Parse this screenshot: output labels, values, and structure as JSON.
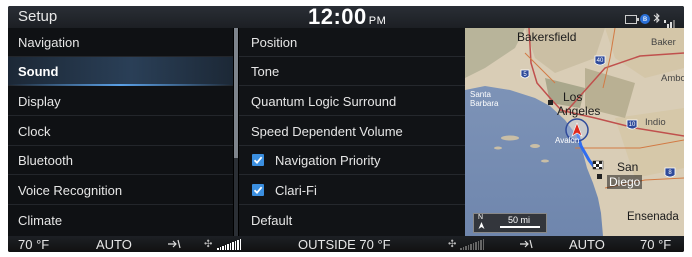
{
  "topbar": {
    "title": "Setup",
    "time": "12:00",
    "ampm": "PM"
  },
  "left_menu": {
    "items": [
      {
        "label": "Navigation"
      },
      {
        "label": "Sound",
        "active": true
      },
      {
        "label": "Display"
      },
      {
        "label": "Clock"
      },
      {
        "label": "Bluetooth"
      },
      {
        "label": "Voice Recognition"
      },
      {
        "label": "Climate"
      }
    ]
  },
  "sound_menu": {
    "items": [
      {
        "label": "Position"
      },
      {
        "label": "Tone"
      },
      {
        "label": "Quantum Logic Surround"
      },
      {
        "label": "Speed Dependent Volume"
      },
      {
        "label": "Navigation Priority",
        "checked": true
      },
      {
        "label": "Clari-Fi",
        "checked": true
      },
      {
        "label": "Default"
      }
    ]
  },
  "map": {
    "labels": {
      "bakersfield": "Bakersfield",
      "baker": "Baker",
      "ambo": "Ambo",
      "santa_barbara": "Santa Barbara",
      "los_angeles_1": "Los",
      "los_angeles_2": "Angeles",
      "indio": "Indio",
      "avalon": "Avalon",
      "san_diego_1": "San",
      "san_diego_2": "Diego",
      "ensenada": "Ensenada"
    },
    "highway_shields": [
      "5",
      "40",
      "10",
      "8"
    ],
    "scale": {
      "north": "N",
      "distance": "50 mi"
    }
  },
  "climate_bar": {
    "left_temp": "70 °F",
    "left_mode": "AUTO",
    "outside": "OUTSIDE 70 °F",
    "right_mode": "AUTO",
    "right_temp": "70 °F"
  },
  "colors": {
    "accent_blue": "#3b8fe0",
    "route_blue": "#2f6df0",
    "position_red": "#e02a1e"
  }
}
